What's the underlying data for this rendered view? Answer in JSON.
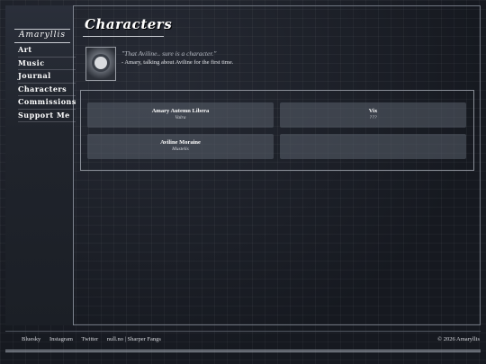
{
  "page": {
    "title": "Characters"
  },
  "nav": {
    "logo": "Amaryllis",
    "items": [
      "Art",
      "Music",
      "Journal",
      "Characters",
      "Commissions",
      "Support Me"
    ]
  },
  "quote": {
    "text": "\"That Aviline.. sure is a character.\"",
    "attribution": "- Amary, talking about Aviline for the first time."
  },
  "cards": [
    {
      "name": "Amary Autemn Libera",
      "sub": "Valra"
    },
    {
      "name": "Vix",
      "sub": "???"
    },
    {
      "name": "Aviline Moraine",
      "sub": "Mustelis"
    },
    {
      "name": "",
      "sub": ""
    }
  ],
  "footer": {
    "links": [
      "Bluesky",
      "Instagram",
      "Twitter",
      "null.no | Sharper Fangs"
    ],
    "copyright": "© 2026 Amaryllis"
  }
}
